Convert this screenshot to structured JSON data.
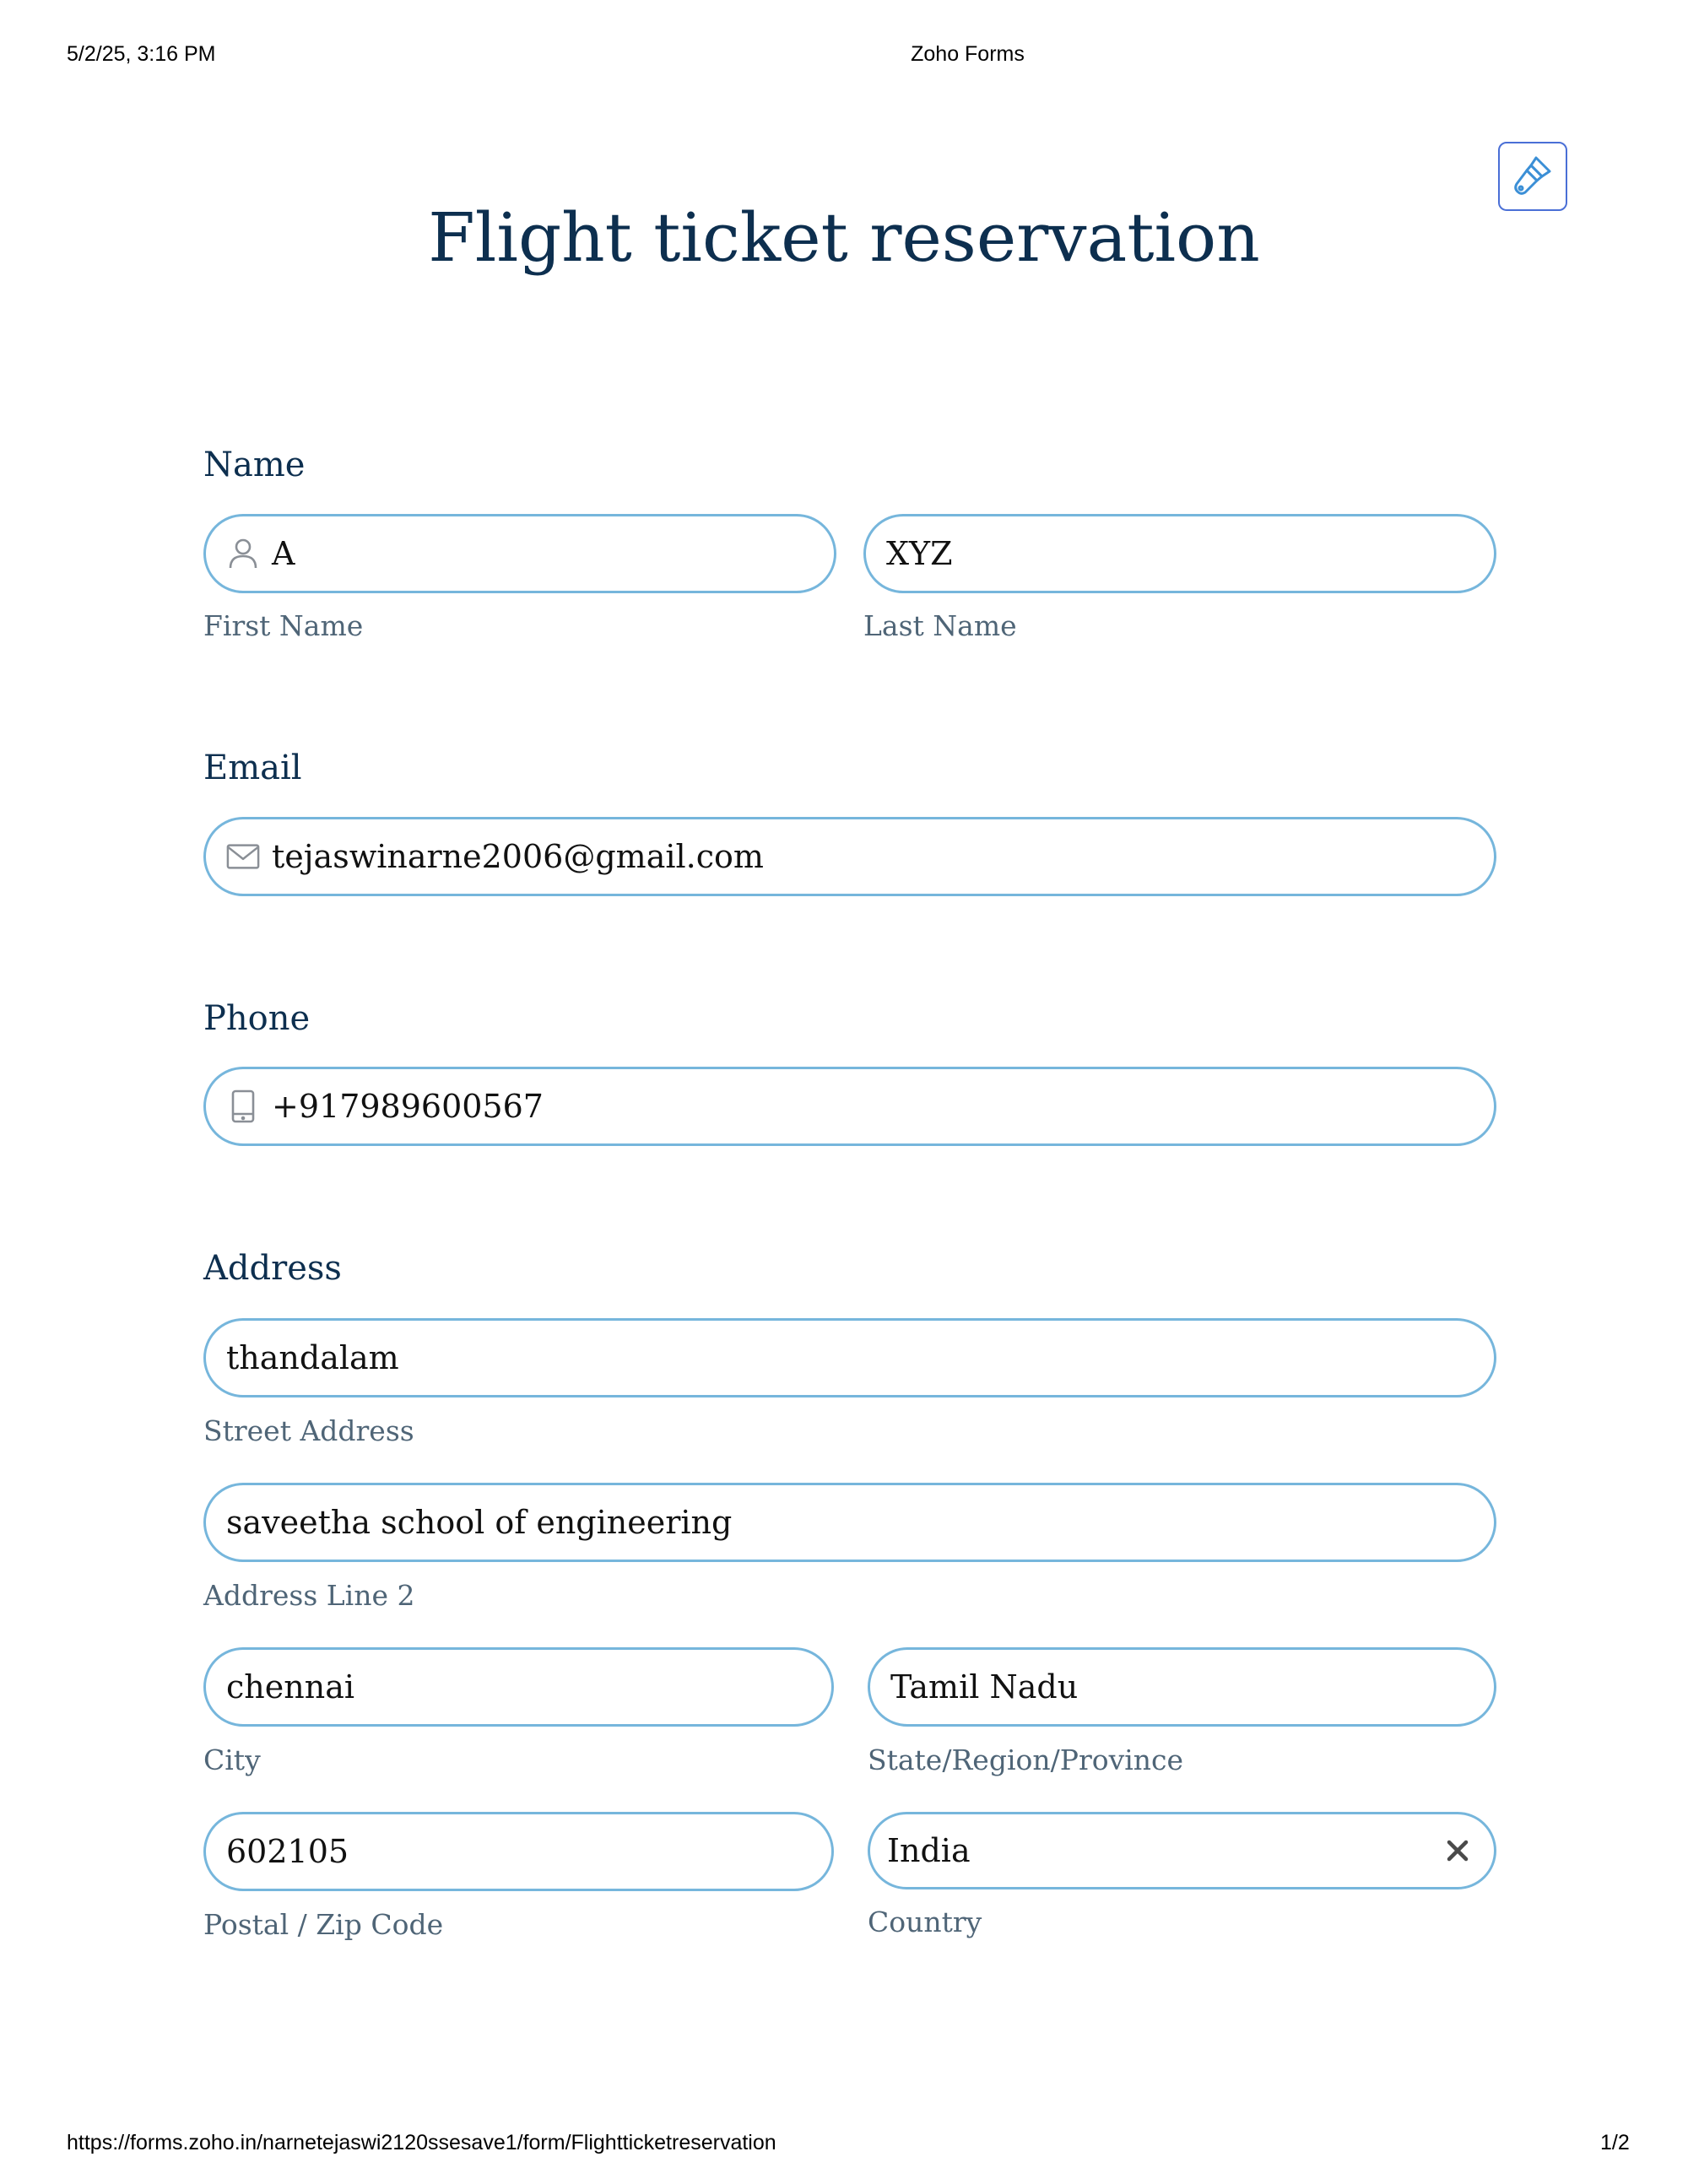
{
  "print_header": {
    "datetime": "5/2/25, 3:16 PM",
    "page_title": "Zoho Forms"
  },
  "form": {
    "title": "Flight ticket reservation",
    "name": {
      "label": "Name",
      "first_value": "A",
      "first_sublabel": "First Name",
      "last_value": "XYZ",
      "last_sublabel": "Last Name"
    },
    "email": {
      "label": "Email",
      "value": "tejaswinarne2006@gmail.com"
    },
    "phone": {
      "label": "Phone",
      "value": "+917989600567"
    },
    "address": {
      "label": "Address",
      "street_value": "thandalam",
      "street_sublabel": "Street Address",
      "line2_value": "saveetha school of engineering",
      "line2_sublabel": "Address Line 2",
      "city_value": "chennai",
      "city_sublabel": "City",
      "state_value": "Tamil Nadu",
      "state_sublabel": "State/Region/Province",
      "zip_value": "602105",
      "zip_sublabel": "Postal / Zip Code",
      "country_value": "India",
      "country_sublabel": "Country"
    }
  },
  "print_footer": {
    "url": "https://forms.zoho.in/narnetejaswi2120ssesave1/form/Flightticketreservation",
    "page": "1/2"
  },
  "colors": {
    "title": "#0d2f4f",
    "input_border": "#76b6dc",
    "sublabel": "#4f6577",
    "theme_button": "#4a6fd6"
  },
  "icons": {
    "theme": "paint-brush-icon",
    "name": "person-icon",
    "email": "envelope-icon",
    "phone": "mobile-phone-icon",
    "clear": "close-icon"
  }
}
